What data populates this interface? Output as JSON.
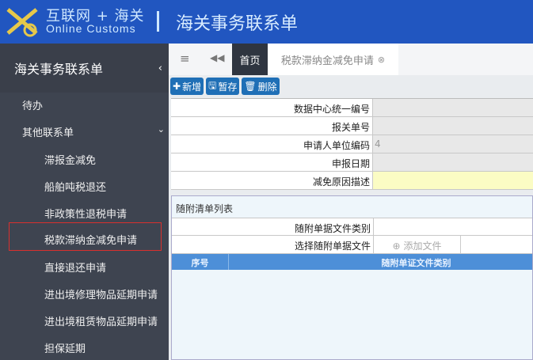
{
  "header": {
    "brand_cn": "互联网 + 海关",
    "brand_en": "Online Customs",
    "title": "海关事务联系单"
  },
  "sidebar": {
    "title": "海关事务联系单",
    "items": [
      {
        "label": "待办"
      },
      {
        "label": "其他联系单"
      },
      {
        "label": "滞报金减免"
      },
      {
        "label": "船舶吨税退还"
      },
      {
        "label": "非政策性退税申请"
      },
      {
        "label": "税款滞纳金减免申请"
      },
      {
        "label": "直接退还申请"
      },
      {
        "label": "进出境修理物品延期申请"
      },
      {
        "label": "进出境租赁物品延期申请"
      },
      {
        "label": "担保延期"
      }
    ]
  },
  "tabs": {
    "home": "首页",
    "current": "税款滞纳金减免申请"
  },
  "toolbar": {
    "add": "新增",
    "save": "暂存",
    "delete": "删除"
  },
  "form": {
    "fields": [
      {
        "label": "数据中心统一编号",
        "value": ""
      },
      {
        "label": "报关单号",
        "value": ""
      },
      {
        "label": "申请人单位编码",
        "value": "4"
      },
      {
        "label": "申报日期",
        "value": ""
      },
      {
        "label": "减免原因描述",
        "value": ""
      }
    ]
  },
  "attachments": {
    "title": "随附清单列表",
    "type_label": "随附单据文件类别",
    "file_label": "选择随附单据文件",
    "add_file": "添加文件",
    "columns": [
      "序号",
      "随附单证文件类别"
    ]
  },
  "colors": {
    "header": "#2156c0",
    "sidebar": "#3e4450",
    "table_header": "#4d8fd8",
    "highlight": "#d9302e"
  }
}
